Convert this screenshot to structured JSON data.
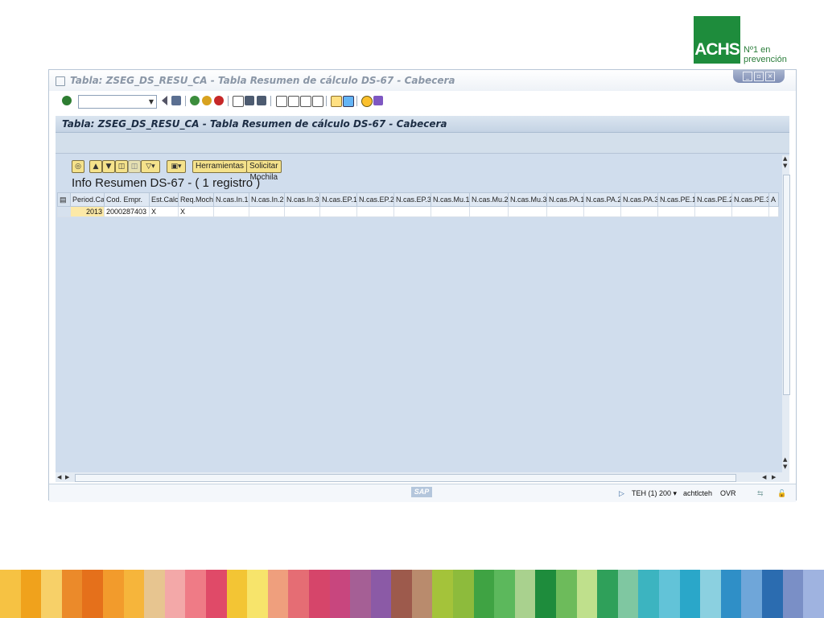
{
  "brand": {
    "logo_text": "ACHS",
    "tagline_line1": "Nº1 en",
    "tagline_line2": "prevención",
    "color": "#1e8c3c"
  },
  "window": {
    "title": "Tabla: ZSEG_DS_RESU_CA - Tabla Resumen de cálculo DS-67 - Cabecera",
    "controls": [
      "minimize-icon",
      "restore-icon",
      "close-icon"
    ]
  },
  "toolbar": {
    "command_field_value": "",
    "icons": [
      "enter-icon",
      "back-icon",
      "save-icon",
      "back-green-icon",
      "exit-icon",
      "cancel-icon",
      "print-icon",
      "find-icon",
      "find-next-icon",
      "first-page-icon",
      "prev-page-icon",
      "next-page-icon",
      "last-page-icon",
      "new-session-icon",
      "shortcut-icon",
      "help-icon",
      "layout-icon"
    ]
  },
  "screen": {
    "heading": "Tabla: ZSEG_DS_RESU_CA - Tabla Resumen de cálculo DS-67 - Cabecera"
  },
  "alv": {
    "buttons": {
      "herramientas": "Herramientas",
      "mochila": "Solicitar Mochila"
    },
    "list_title": "Info Resumen DS-67 - ( 1 registro )",
    "columns": [
      "Period.Cal",
      "Cod. Empr.",
      "Est.Calc.",
      "Req.Moch.",
      "N.cas.In.1",
      "N.cas.In.2",
      "N.cas.In.3",
      "N.cas.EP.1",
      "N.cas.EP.2",
      "N.cas.EP.3",
      "N.cas.Mu.1",
      "N.cas.Mu.2",
      "N.cas.Mu.3",
      "N.cas.PA.1",
      "N.cas.PA.2",
      "N.cas.PA.3",
      "N.cas.PE.1",
      "N.cas.PE.2",
      "N.cas.PE.3",
      "A"
    ],
    "rows": [
      [
        "2013",
        "2000287403",
        "X",
        "X",
        "",
        "",
        "",
        "",
        "",
        "",
        "",
        "",
        "",
        "",
        "",
        "",
        "",
        "",
        "",
        ""
      ]
    ]
  },
  "status": {
    "session": "TEH (1) 200",
    "user": "achtlcteh",
    "mode": "OVR",
    "sap_logo": "SAP"
  },
  "stripes": [
    "#f6c243",
    "#f0a21c",
    "#f7d068",
    "#eb8a2a",
    "#e5701b",
    "#f29b2c",
    "#f6b53b",
    "#e7c590",
    "#f3a8a8",
    "#ef7b86",
    "#e04a68",
    "#f3c534",
    "#f7e46b",
    "#ef9f7d",
    "#e56d74",
    "#d6456a",
    "#c8467e",
    "#a55f95",
    "#8b5aa6",
    "#9d5a4c",
    "#b98b6d",
    "#a4c33a",
    "#8dbb3c",
    "#3fa343",
    "#5cb85c",
    "#a9d18e",
    "#1e8c3c",
    "#6dbb5b",
    "#bfe08c",
    "#2fa05a",
    "#7fc7a1",
    "#3cb4c0",
    "#62c3d8",
    "#2aa7c9",
    "#8bd0e0",
    "#2f8fc7",
    "#6fa6d9",
    "#2b6cb0",
    "#7a8fc6",
    "#9fb3e0"
  ]
}
